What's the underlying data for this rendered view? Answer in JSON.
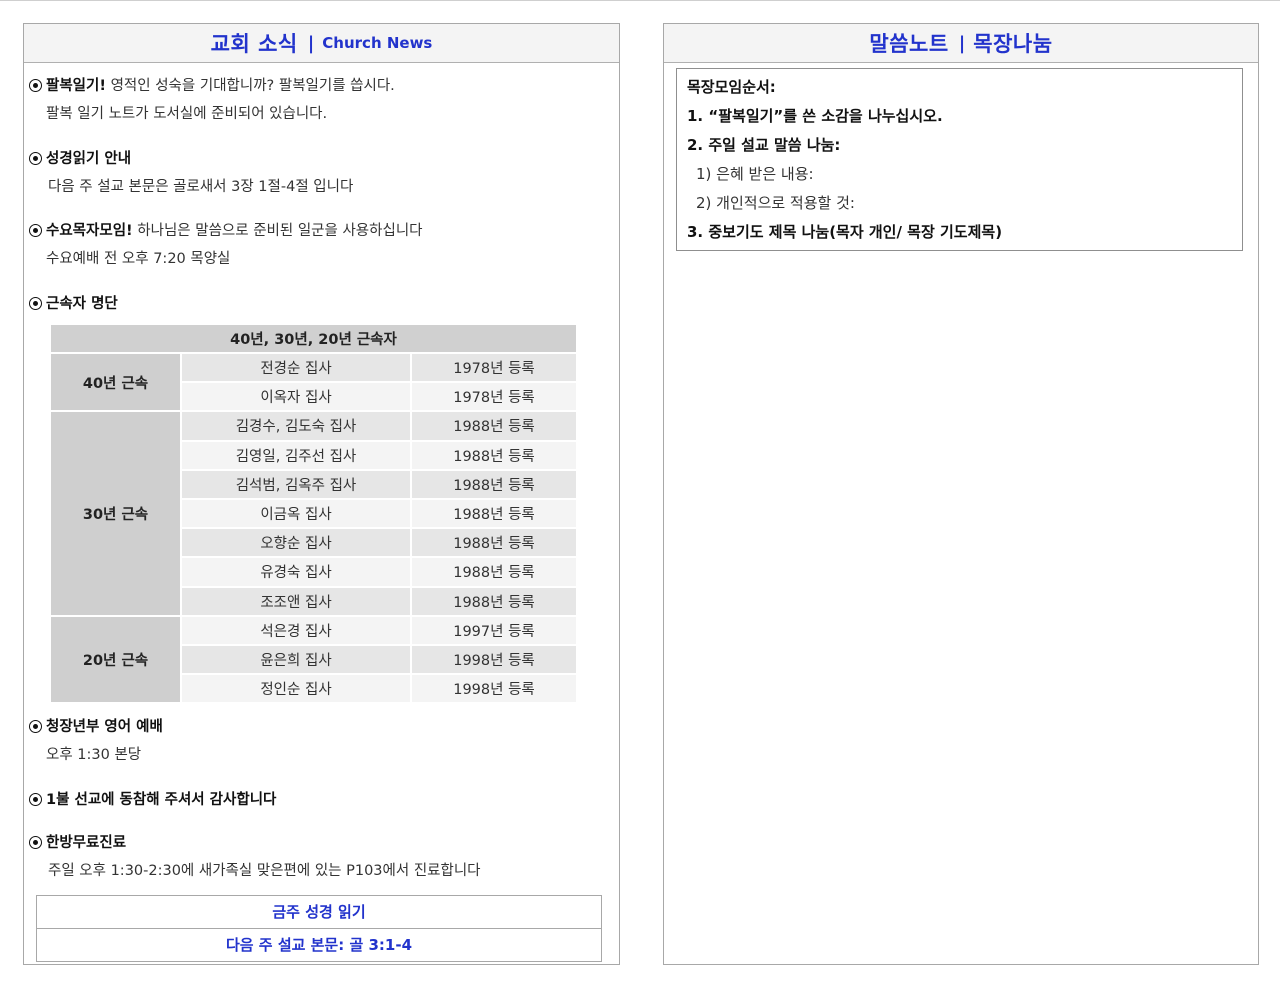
{
  "left_panel": {
    "title_ko": "교회 소식",
    "separator": "|",
    "title_en": "Church News",
    "notices": [
      {
        "title": "팔복일기!",
        "desc": " 영적인 성숙을 기대합니까? 팔복일기를 씁시다.",
        "line2": "팔복 일기 노트가 도서실에 준비되어 있습니다."
      },
      {
        "title": "성경읽기 안내",
        "desc": "",
        "line2": "다음 주 설교 본문은 골로새서 3장 1절-4절 입니다"
      },
      {
        "title": "수요목자모임!",
        "desc": " 하나님은 말씀으로 준비된 일군을 사용하십니다",
        "line2": "수요예배 전 오후 7:20 목양실"
      },
      {
        "title": "근속자 명단",
        "desc": "",
        "line2": ""
      }
    ],
    "roster": {
      "header": "40년, 30년, 20년 근속자",
      "groups": [
        {
          "label": "40년 근속",
          "rows": [
            {
              "name": "전경순 집사",
              "year": "1978년 등록"
            },
            {
              "name": "이옥자 집사",
              "year": "1978년 등록"
            }
          ]
        },
        {
          "label": "30년 근속",
          "rows": [
            {
              "name": "김경수, 김도숙 집사",
              "year": "1988년 등록"
            },
            {
              "name": "김영일, 김주선 집사",
              "year": "1988년 등록"
            },
            {
              "name": "김석범, 김옥주 집사",
              "year": "1988년 등록"
            },
            {
              "name": "이금옥 집사",
              "year": "1988년 등록"
            },
            {
              "name": "오향순 집사",
              "year": "1988년 등록"
            },
            {
              "name": "유경숙 집사",
              "year": "1988년 등록"
            },
            {
              "name": "조조앤 집사",
              "year": "1988년 등록"
            }
          ]
        },
        {
          "label": "20년 근속",
          "rows": [
            {
              "name": "석은경 집사",
              "year": "1997년 등록"
            },
            {
              "name": "윤은희 집사",
              "year": "1998년 등록"
            },
            {
              "name": "정인순 집사",
              "year": "1998년 등록"
            }
          ]
        }
      ]
    },
    "notices_after": [
      {
        "title": "청장년부 영어 예배",
        "line2": "오후 1:30 본당"
      },
      {
        "title": "1불 선교에 동참해 주셔서 감사합니다",
        "line2": ""
      },
      {
        "title": "한방무료진료",
        "line2": "주일 오후 1:30-2:30에 새가족실 맞은편에 있는 P103에서 진료합니다"
      }
    ],
    "bible_box": {
      "line1": "금주 성경 읽기",
      "line2": "다음 주 설교 본문:  골 3:1-4"
    }
  },
  "right_panel": {
    "title_a": "말씀노트",
    "separator": "|",
    "title_b": "목장나눔",
    "agenda": {
      "heading": "목장모임순서:",
      "item1": "1. “팔복일기”를 쓴 소감을 나누십시오.",
      "item2": "2. 주일 설교 말씀 나눔:",
      "item2_sub1": "1) 은혜 받은 내용:",
      "item2_sub2": "2) 개인적으로 적용할 것:",
      "item3": "3. 중보기도 제목 나눔(목자 개인/ 목장 기도제목)"
    }
  },
  "colors": {
    "accent": "#2233cc",
    "header_bg": "#f4f4f4",
    "table_group": "#cfcfcf"
  }
}
